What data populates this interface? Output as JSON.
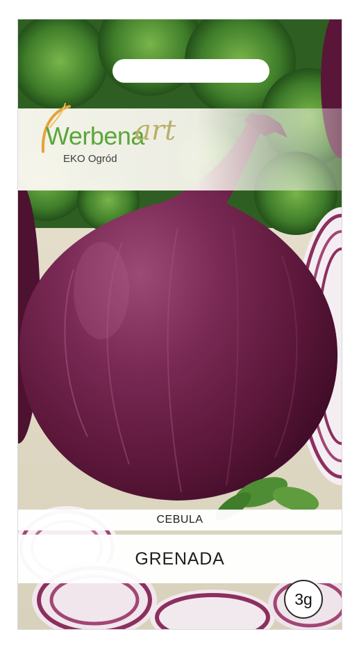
{
  "brand": {
    "name": "Werbena",
    "suffix": "art",
    "tagline": "EKO Ogród",
    "color_green": "#5aa63a",
    "color_olive": "#b9b06a"
  },
  "product": {
    "crop": "CEBULA",
    "variety": "GRENADA",
    "weight": "3g"
  },
  "colors": {
    "onion": "#6e1f45",
    "parsley": "#3f7d2a",
    "background": "#f2efe3"
  }
}
